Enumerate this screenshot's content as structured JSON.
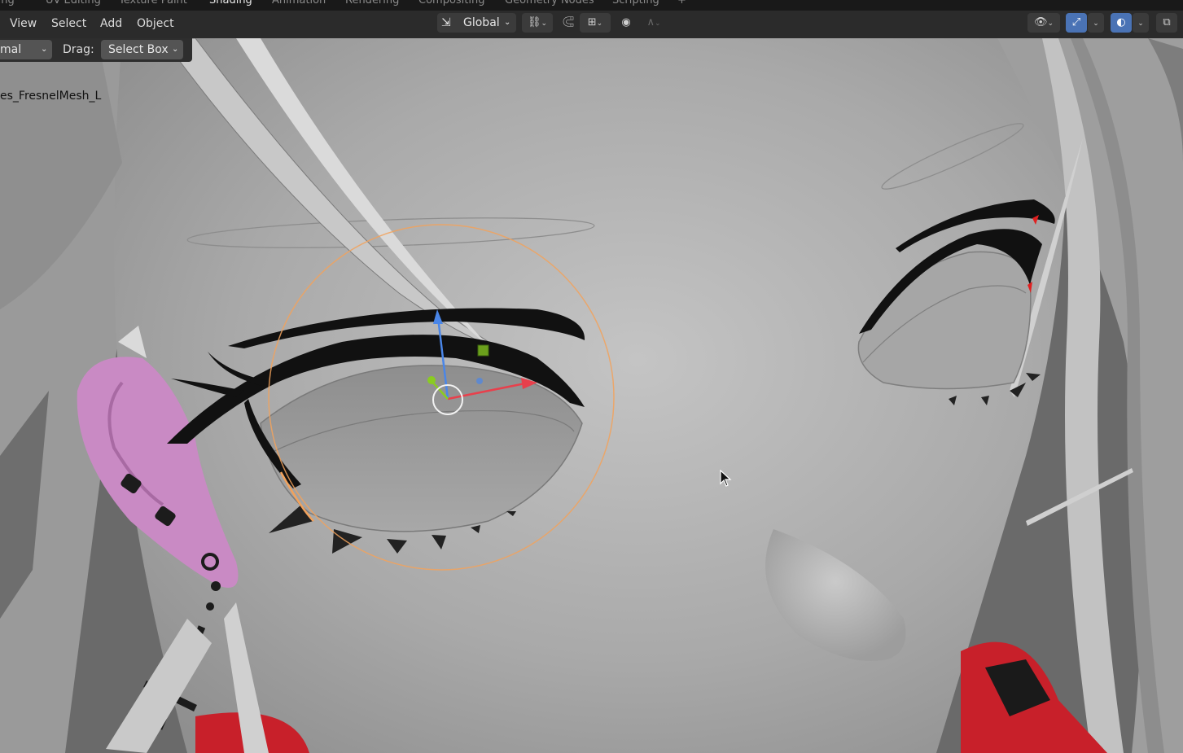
{
  "workspace_tabs": [
    "ling",
    "UV Editing",
    "Texture Paint",
    "Shading",
    "Animation",
    "Rendering",
    "Compositing",
    "Geometry Nodes",
    "Scripting",
    "+"
  ],
  "active_tab": "Shading",
  "header_menu": [
    "View",
    "Select",
    "Add",
    "Object"
  ],
  "transform": {
    "orientation_label": "Global"
  },
  "operator_bar": {
    "mode_label": "mal",
    "drag_label": "Drag:",
    "drag_value": "Select Box"
  },
  "viewport": {
    "object_name": "es_FresnelMesh_L"
  },
  "colors": {
    "accent": "#4a73b5",
    "header_bg": "#2b2b2b",
    "topbar_bg": "#191919",
    "dropdown_bg": "#545454",
    "skin": "#a9a9a9",
    "ear": "#c98ac4",
    "gizmo_x": "#e8404c",
    "gizmo_y": "#8acc21",
    "gizmo_z": "#4a86e8",
    "selection_outline": "#f2a25c"
  },
  "icons": [
    "orientation-icon",
    "pivot-icon",
    "snap-icon",
    "snap-increment-icon",
    "proportional-edit-icon",
    "falloff-icon",
    "visibility-icon",
    "gizmo-icon",
    "overlay-icon",
    "xray-icon",
    "chevron-down-icon",
    "mouse-cursor-icon"
  ]
}
